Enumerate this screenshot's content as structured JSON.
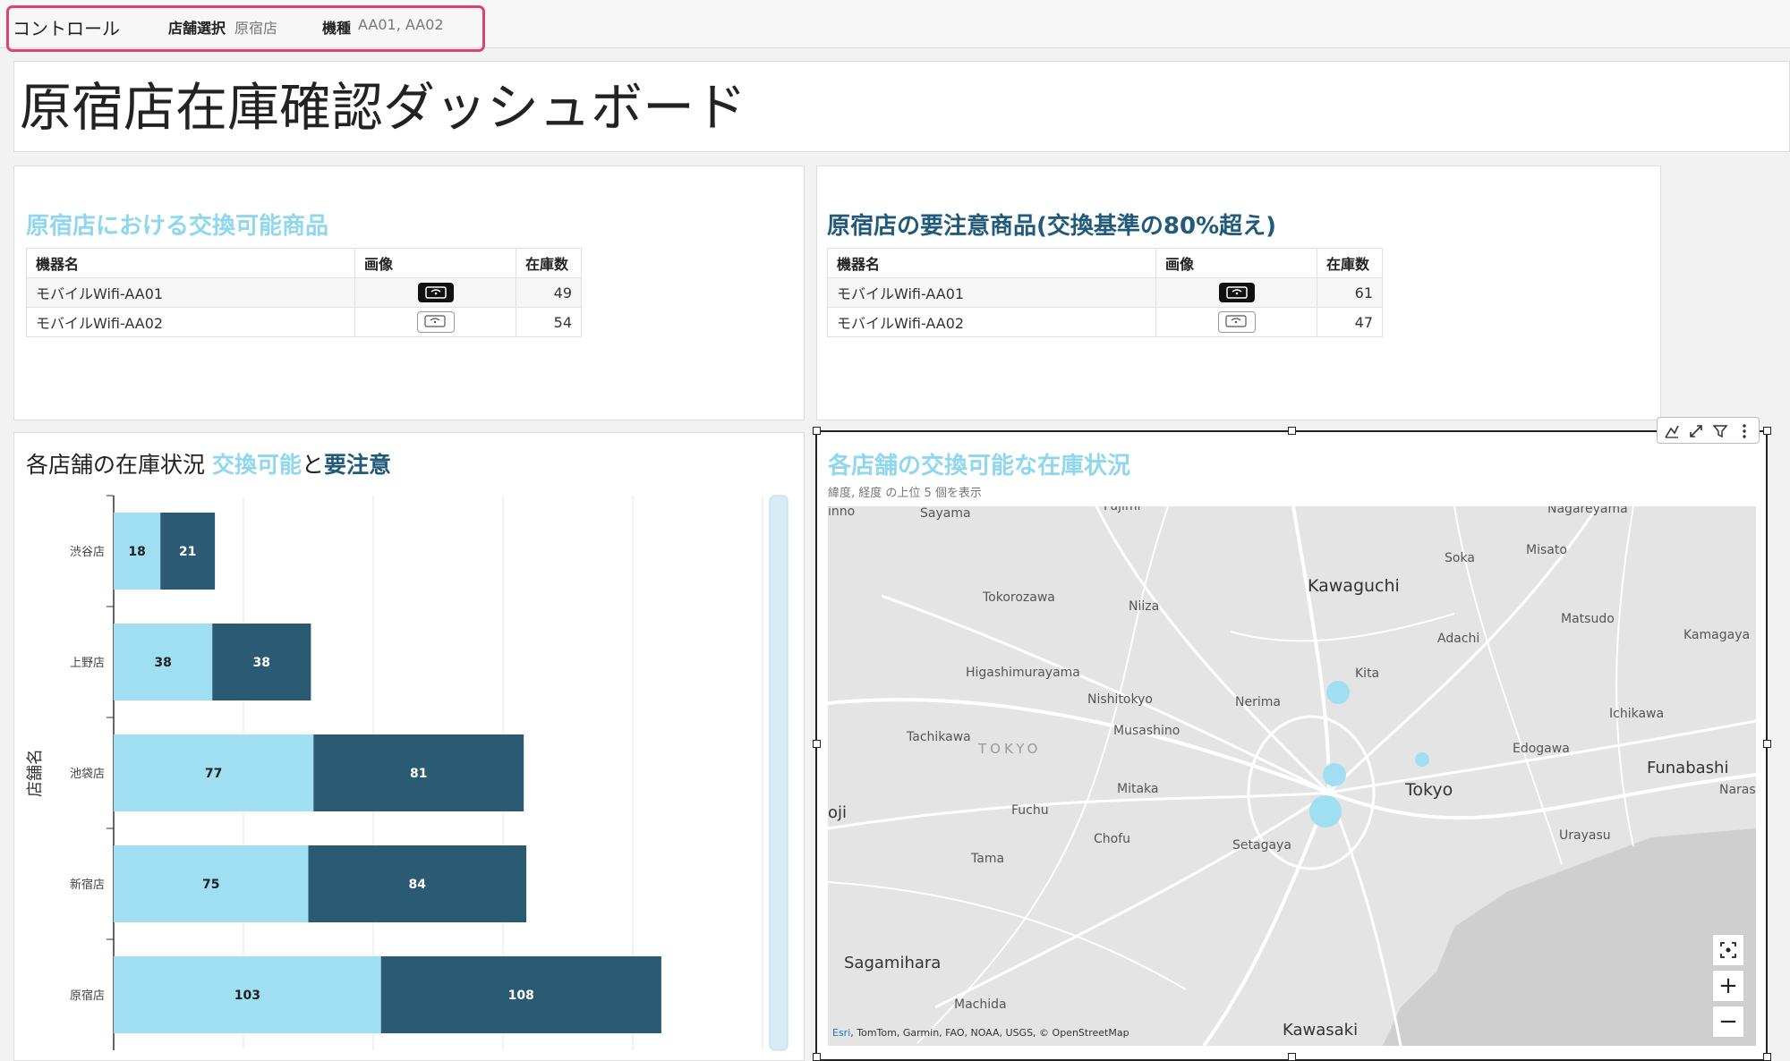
{
  "controls": {
    "label": "コントロール",
    "store_label": "店舗選択",
    "store_value": "原宿店",
    "model_label": "機種",
    "model_value": "AA01, AA02"
  },
  "dashboard_title": "原宿店在庫確認ダッシュボード",
  "table_exchangeable": {
    "title": "原宿店における交換可能商品",
    "headers": [
      "機器名",
      "画像",
      "在庫数"
    ],
    "rows": [
      {
        "name": "モバイルWifi-AA01",
        "qty": "49",
        "icon": "router-dark-icon"
      },
      {
        "name": "モバイルWifi-AA02",
        "qty": "54",
        "icon": "router-light-icon"
      }
    ]
  },
  "table_caution": {
    "title": "原宿店の要注意商品(交換基準の80%超え)",
    "headers": [
      "機器名",
      "画像",
      "在庫数"
    ],
    "rows": [
      {
        "name": "モバイルWifi-AA01",
        "qty": "61",
        "icon": "router-dark-icon"
      },
      {
        "name": "モバイルWifi-AA02",
        "qty": "47",
        "icon": "router-light-icon"
      }
    ]
  },
  "stock_chart": {
    "title_prefix": "各店舗の在庫状況 ",
    "title_series1": "交換可能",
    "title_join": "と",
    "title_series2": "要注意"
  },
  "chart_data": {
    "type": "bar",
    "orientation": "horizontal",
    "stacked": true,
    "categories": [
      "渋谷店",
      "上野店",
      "池袋店",
      "新宿店",
      "原宿店"
    ],
    "series": [
      {
        "name": "交換可能",
        "values": [
          18,
          38,
          77,
          75,
          103
        ],
        "color": "#a0dff2"
      },
      {
        "name": "要注意",
        "values": [
          21,
          38,
          81,
          84,
          108
        ],
        "color": "#2b5a73"
      }
    ],
    "ylabel": "店舗名",
    "xlim": [
      0,
      250
    ],
    "x_gridlines": [
      0,
      50,
      100,
      150,
      200,
      250
    ],
    "grid": true
  },
  "map": {
    "title": "各店舗の交換可能な在庫状況",
    "subtitle": "緯度, 経度 の上位 5 個を表示",
    "attribution_esri": "Esri",
    "attribution_rest": ", TomTom, Garmin, FAO, NOAA, USGS, © OpenStreetMap",
    "labels": {
      "inno": "inno",
      "sayama": "Sayama",
      "fujimi": "Fujimi",
      "nagareyama": "Nagareyama",
      "soka": "Soka",
      "misato": "Misato",
      "kawaguchi": "Kawaguchi",
      "tokorozawa": "Tokorozawa",
      "niiza": "Niiza",
      "adachi": "Adachi",
      "matsudo": "Matsudo",
      "kamagaya": "Kamagaya",
      "kita": "Kita",
      "higashimurayama": "Higashimurayama",
      "nishitokyo": "Nishitokyo",
      "nerima": "Nerima",
      "ichikawa": "Ichikawa",
      "musashino": "Musashino",
      "tachikawa": "Tachikawa",
      "tokyo_pref": "TOKYO",
      "edogawa": "Edogawa",
      "funabashi": "Funabashi",
      "narash": "Narash",
      "tokyo": "Tokyo",
      "mitaka": "Mitaka",
      "oji": "oji",
      "fuchu": "Fuchu",
      "chofu": "Chofu",
      "setagaya": "Setagaya",
      "urayasu": "Urayasu",
      "tama": "Tama",
      "sagamihara": "Sagamihara",
      "machida": "Machida",
      "kawasaki": "Kawasaki"
    },
    "zoom_in": "+",
    "zoom_out": "−"
  },
  "colors": {
    "accent_light": "#8fd6ef",
    "accent_dark": "#215a7a",
    "highlight_border": "#e0407a"
  }
}
